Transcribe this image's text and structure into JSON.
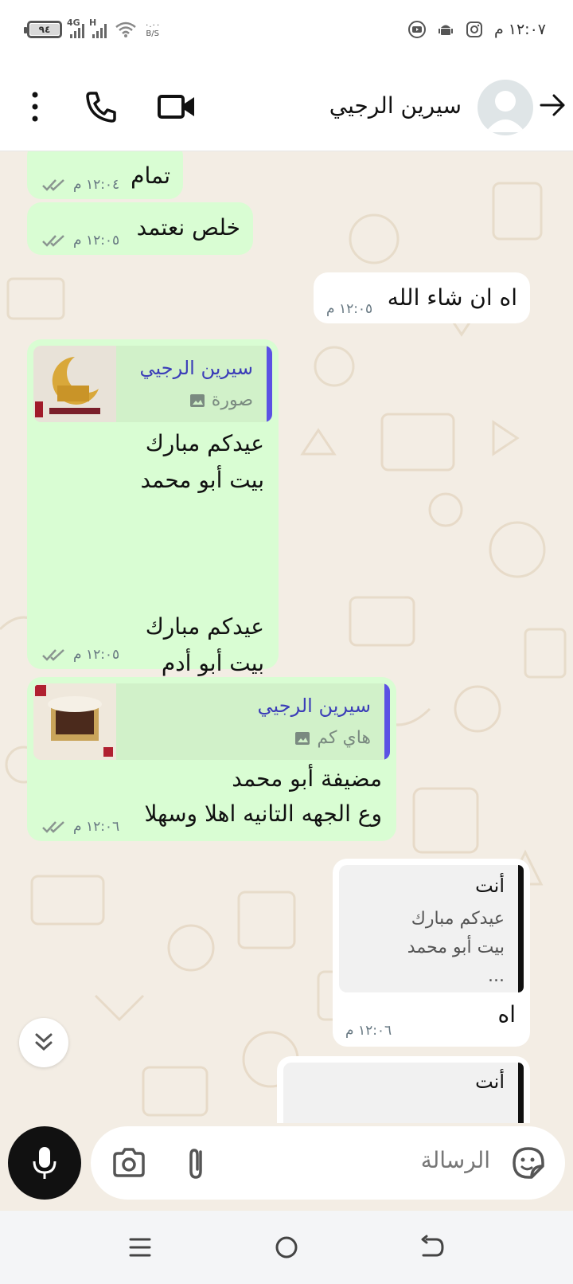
{
  "status_bar": {
    "time": "١٢:٠٧ م",
    "battery": "٩٤",
    "network": "4G",
    "network2": "H",
    "speed_value": "٠.٠٠",
    "speed_unit": "B/S"
  },
  "header": {
    "contact_name": "سيرين الرجيي"
  },
  "messages": [
    {
      "text": "تمام",
      "time": "١٢:٠٤ م"
    },
    {
      "text": "خلص نعتمد",
      "time": "١٢:٠٥ م"
    },
    {
      "text": "اه ان شاء الله",
      "time": "١٢:٠٥ م"
    },
    {
      "quote_name": "سيرين الرجيي",
      "quote_sub": "صورة",
      "text": "عيدكم مبارك\nبيت أبو محمد\n\n\n\nعيدكم مبارك\nبيت أبو أدم",
      "time": "١٢:٠٥ م"
    },
    {
      "quote_name": "سيرين الرجيي",
      "quote_sub": "هاي كم",
      "text": "مضيفة أبو محمد\nوع الجهه التانيه اهلا وسهلا",
      "time": "١٢:٠٦ م"
    },
    {
      "quote_name": "أنت",
      "quote_text": "عيدكم مبارك\nبيت أبو محمد\n...",
      "text": "اه",
      "time": "١٢:٠٦ م"
    },
    {
      "quote_name": "أنت"
    }
  ],
  "input": {
    "placeholder": "الرسالة"
  },
  "colors": {
    "incoming_bubble": "#d9fdd3",
    "outgoing_bubble": "#ffffff",
    "chat_background": "#f3ede4",
    "quote_accent": "#5b51e4"
  }
}
